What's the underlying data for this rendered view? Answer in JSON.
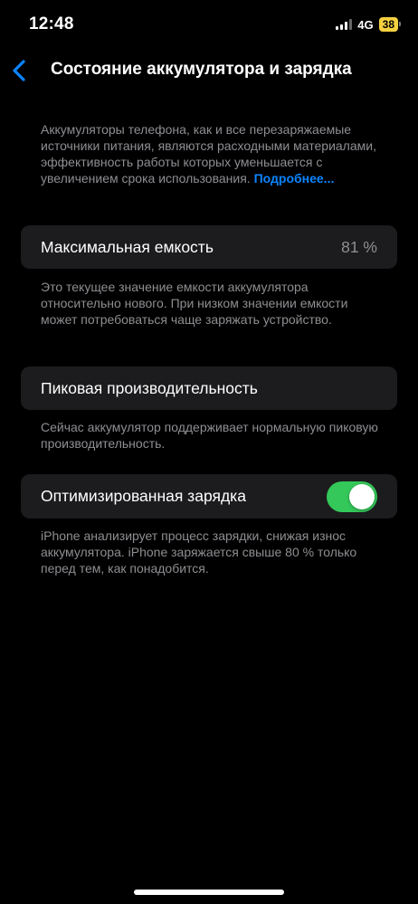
{
  "status_bar": {
    "time": "12:48",
    "network": "4G",
    "battery_level": "38",
    "battery_color": "#f4d03f"
  },
  "nav": {
    "back_icon": "chevron-left-icon",
    "title": "Состояние аккумулятора и зарядка"
  },
  "intro": {
    "text": "Аккумуляторы телефона, как и все перезаряжаемые источники питания, являются расходными материалами, эффективность работы которых уменьшается с увеличением срока использования. ",
    "link": "Подробнее..."
  },
  "max_capacity": {
    "label": "Максимальная емкость",
    "value": "81 %",
    "footnote": "Это текущее значение емкости аккумулятора относительно нового. При низком значении емкости может потребоваться чаще заряжать устройство."
  },
  "peak_performance": {
    "label": "Пиковая производительность",
    "footnote": "Сейчас аккумулятор поддерживает нормальную пиковую производительность."
  },
  "optimized_charging": {
    "label": "Оптимизированная зарядка",
    "enabled": true,
    "toggle_color": "#34c759",
    "footnote": "iPhone анализирует процесс зарядки, снижая износ аккумулятора. iPhone заряжается свыше 80 % только перед тем, как понадобится."
  },
  "colors": {
    "accent": "#0a84ff",
    "background": "#000000",
    "card": "#1c1c1e",
    "secondary_text": "#8e8e93"
  }
}
